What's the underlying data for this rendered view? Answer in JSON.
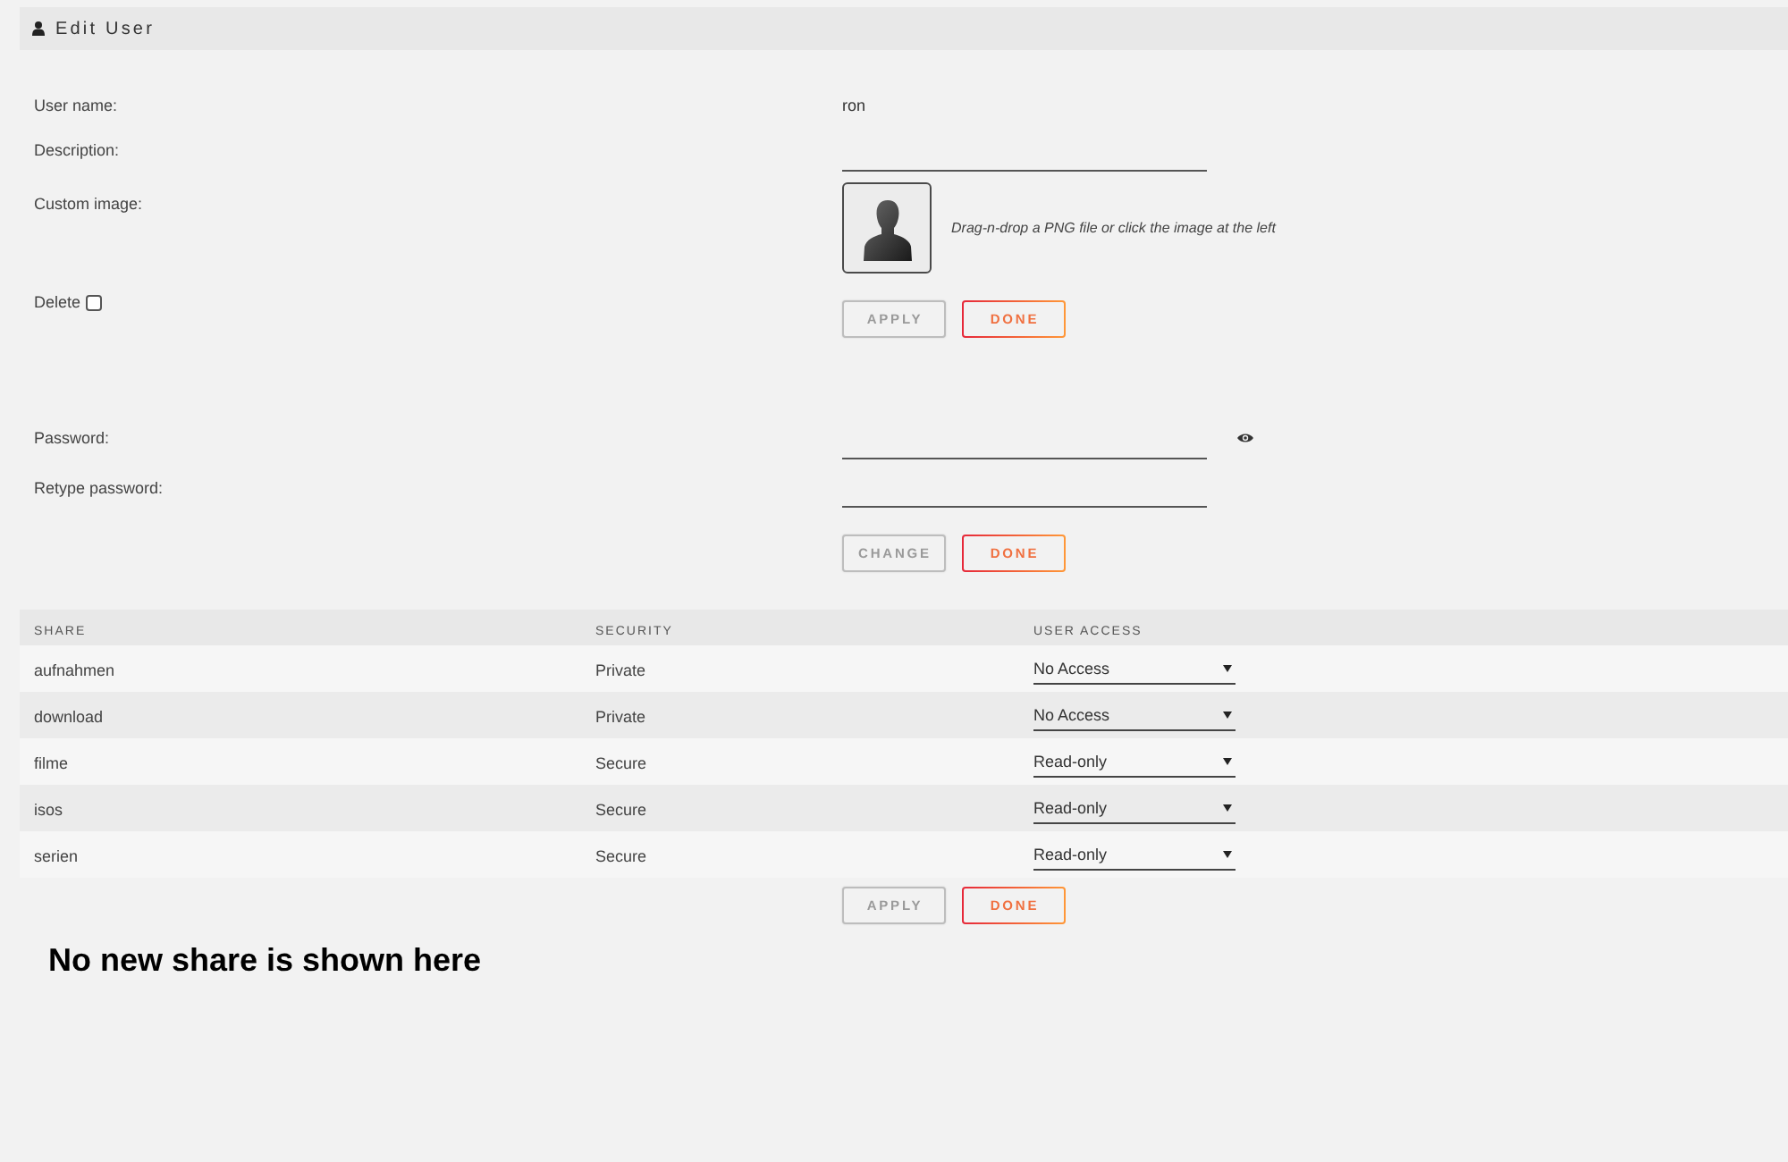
{
  "header": {
    "title": "Edit User"
  },
  "user_form": {
    "user_name": {
      "label": "User name:",
      "value": "ron"
    },
    "description": {
      "label": "Description:"
    },
    "custom_image": {
      "label": "Custom image:",
      "hint": "Drag-n-drop a PNG file or click the image at the left"
    },
    "delete": {
      "label": "Delete",
      "checked": false
    },
    "buttons": [
      {
        "label": "APPLY",
        "disabled": true
      },
      {
        "label": "DONE",
        "disabled": false
      }
    ]
  },
  "password_form": {
    "password": {
      "label": "Password:"
    },
    "retype": {
      "label": "Retype password:"
    },
    "buttons": [
      {
        "label": "CHANGE",
        "disabled": true
      },
      {
        "label": "DONE",
        "disabled": false
      }
    ]
  },
  "shares_table": {
    "columns": [
      "SHARE",
      "SECURITY",
      "USER ACCESS"
    ],
    "rows": [
      {
        "share": "aufnahmen",
        "security": "Private",
        "user_access": "No Access"
      },
      {
        "share": "download",
        "security": "Private",
        "user_access": "No Access"
      },
      {
        "share": "filme",
        "security": "Secure",
        "user_access": "Read-only"
      },
      {
        "share": "isos",
        "security": "Secure",
        "user_access": "Read-only"
      },
      {
        "share": "serien",
        "security": "Secure",
        "user_access": "Read-only"
      }
    ]
  },
  "share_buttons": [
    {
      "label": "APPLY",
      "disabled": true
    },
    {
      "label": "DONE",
      "disabled": false
    }
  ],
  "note": "No new share is shown here"
}
